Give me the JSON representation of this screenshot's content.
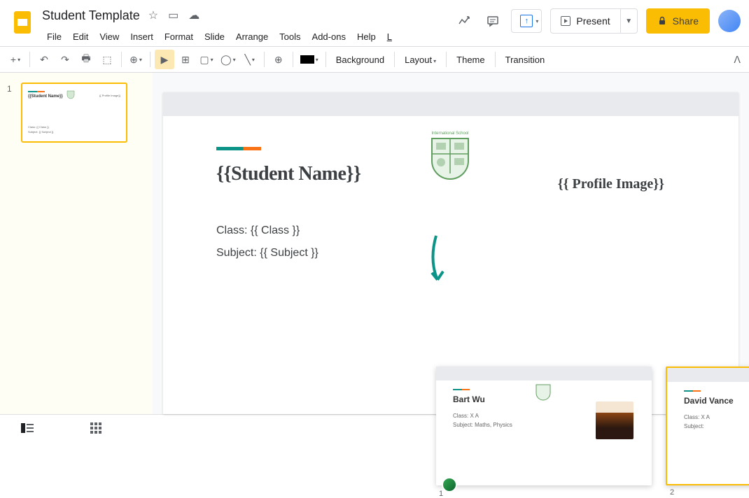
{
  "doc_title": "Student Template",
  "menu": {
    "file": "File",
    "edit": "Edit",
    "view": "View",
    "insert": "Insert",
    "format": "Format",
    "slide": "Slide",
    "arrange": "Arrange",
    "tools": "Tools",
    "addons": "Add-ons",
    "help": "Help",
    "last": "L"
  },
  "header": {
    "present": "Present",
    "share": "Share"
  },
  "toolbar": {
    "background": "Background",
    "layout": "Layout",
    "theme": "Theme",
    "transition": "Transition"
  },
  "sidebar": {
    "slide_num": "1",
    "title": "{{Student Name}}",
    "profile": "{{ Profile Image}}",
    "class": "Class: {{ Class }}",
    "subject": "Subject: {{ Subject }}"
  },
  "slide": {
    "title": "{{Student Name}}",
    "class": "Class: {{ Class }}",
    "subject": "Subject: {{ Subject }}",
    "profile": "{{ Profile Image}}"
  },
  "cards": [
    {
      "num": "1",
      "name": "Bart Wu",
      "class": "Class: X A",
      "subject": "Subject: Maths, Physics"
    },
    {
      "num": "2",
      "name": "David Vance",
      "class": "Class: X A",
      "subject": "Subject:"
    }
  ]
}
